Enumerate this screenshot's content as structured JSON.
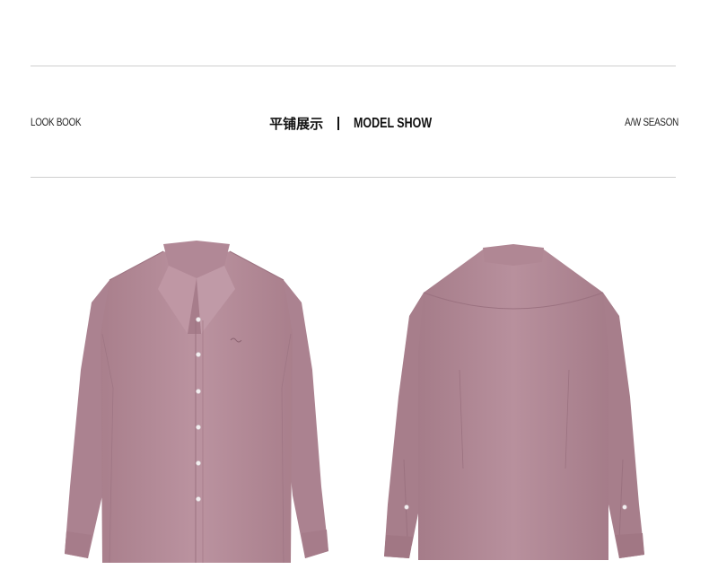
{
  "header": {
    "left_label": "LOOK BOOK",
    "center_cn": "平铺展示",
    "center_en": "MODEL SHOW",
    "right_label": "A/W SEASON"
  },
  "products": {
    "front": {
      "icon": "shirt-front-icon",
      "color": "#b48c98"
    },
    "back": {
      "icon": "shirt-back-icon",
      "color": "#b48c98"
    }
  },
  "colors": {
    "shirt": "#b48c98",
    "shirt_shadow": "#a27a86",
    "rule": "#cfcfcf",
    "text": "#111111"
  }
}
